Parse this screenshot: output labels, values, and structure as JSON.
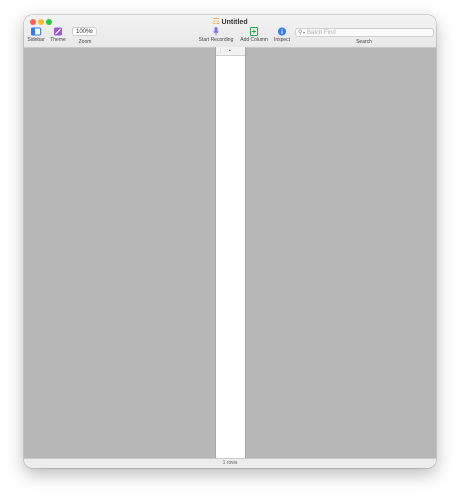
{
  "window": {
    "title": "Untitled"
  },
  "toolbar": {
    "sidebar_label": "Sidebar",
    "theme_label": "Theme",
    "zoom_value": "100%",
    "zoom_label": "Zoom",
    "start_recording_label": "Start Recording",
    "add_column_label": "Add Column",
    "inspect_label": "Inspect",
    "search_placeholder": "Batch Find",
    "search_label": "Search"
  },
  "table": {
    "header_marker": "•"
  },
  "status": {
    "rows_text": "1 rows"
  },
  "colors": {
    "background": "#b7b7b7",
    "accent_blue": "#2f7bf6",
    "theme_purple": "#9b59d6",
    "mic_purple": "#7b6cf0",
    "add_green": "#2aa24a",
    "doc_orange": "#f29b1d"
  }
}
